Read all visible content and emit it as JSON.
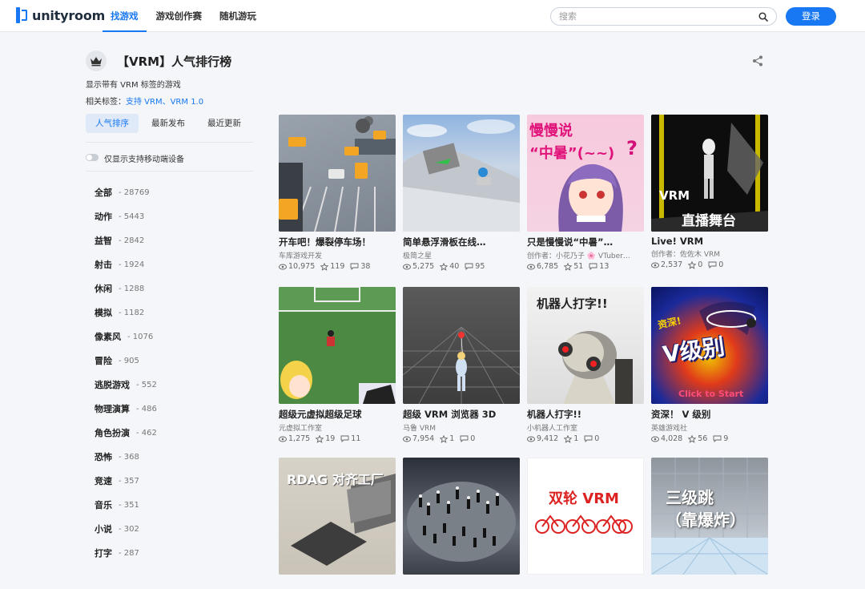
{
  "header": {
    "logo_text": "unityroom",
    "nav": [
      "找游戏",
      "游戏创作赛",
      "随机游玩"
    ],
    "search_placeholder": "搜索",
    "login_label": "登录"
  },
  "page": {
    "title": "【VRM】人气排行榜",
    "description": "显示带有 VRM 标签的游戏",
    "related_prefix": "相关标签：",
    "related_tags": "支持 VRM、VRM 1.0"
  },
  "sort_tabs": [
    "人气排序",
    "最新发布",
    "最近更新"
  ],
  "mobile_toggle_label": "仅显示支持移动端设备",
  "categories": [
    {
      "name": "全部",
      "count": "28769"
    },
    {
      "name": "动作",
      "count": "5443"
    },
    {
      "name": "益智",
      "count": "2842"
    },
    {
      "name": "射击",
      "count": "1924"
    },
    {
      "name": "休闲",
      "count": "1288"
    },
    {
      "name": "模拟",
      "count": "1182"
    },
    {
      "name": "像素风",
      "count": "1076"
    },
    {
      "name": "冒险",
      "count": "905"
    },
    {
      "name": "逃脱游戏",
      "count": "552"
    },
    {
      "name": "物理演算",
      "count": "486"
    },
    {
      "name": "角色扮演",
      "count": "462"
    },
    {
      "name": "恐怖",
      "count": "368"
    },
    {
      "name": "竞速",
      "count": "357"
    },
    {
      "name": "音乐",
      "count": "351"
    },
    {
      "name": "小说",
      "count": "302"
    },
    {
      "name": "打字",
      "count": "287"
    }
  ],
  "games": [
    {
      "title": "开车吧！爆裂停车场！",
      "author": "车库游戏开发",
      "views": "10,975",
      "stars": "119",
      "comments": "38"
    },
    {
      "title": "简单悬浮滑板在线…",
      "author": "极简之星",
      "views": "5,275",
      "stars": "40",
      "comments": "95"
    },
    {
      "title": "只是慢慢说“中暑”…",
      "author": "创作者：小花乃子 🌸 VTuber…",
      "views": "6,785",
      "stars": "51",
      "comments": "13"
    },
    {
      "title": "Live! VRM",
      "author": "创作者：佐佐木 VRM",
      "views": "2,537",
      "stars": "0",
      "comments": "0"
    },
    {
      "title": "超级元虚拟超级足球",
      "author": "元虚拟工作室",
      "views": "1,275",
      "stars": "19",
      "comments": "11"
    },
    {
      "title": "超级 VRM 浏览器 3D",
      "author": "马鲁 VRM",
      "views": "7,954",
      "stars": "1",
      "comments": "0"
    },
    {
      "title": "机器人打字!!",
      "author": "小机器人工作室",
      "views": "9,412",
      "stars": "1",
      "comments": "0"
    },
    {
      "title": "资深！ V 级别",
      "author": "英雄游戏社",
      "views": "4,028",
      "stars": "56",
      "comments": "9"
    }
  ],
  "thumb_texts": {
    "slow_line1": "慢慢说",
    "slow_line2": "“中暑”(~~)",
    "slow_q": "?",
    "live_vrm": "VRM",
    "live_stage": "直播舞台",
    "robot": "机器人打字!!",
    "vlevel_top": "资深!",
    "vlevel_main": "V级别",
    "vlevel_click": "Click to Start",
    "rdag": "RDAG 对齐工厂",
    "bike": "双轮 VRM",
    "jump_1": "三级跳",
    "jump_2": "（靠爆炸）"
  },
  "colors": {
    "accent": "#1877f2"
  }
}
